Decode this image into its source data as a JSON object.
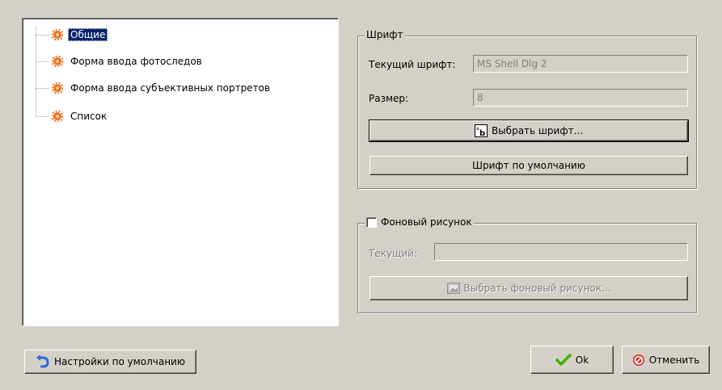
{
  "tree": {
    "items": [
      {
        "label": "Общие",
        "selected": true
      },
      {
        "label": "Форма ввода фотоследов",
        "selected": false
      },
      {
        "label": "Форма ввода субъективных портретов",
        "selected": false
      },
      {
        "label": "Список",
        "selected": false
      }
    ]
  },
  "font_group": {
    "title": "Шрифт",
    "current_label": "Текущий шрифт:",
    "current_value": "MS Shell Dlg 2",
    "size_label": "Размер:",
    "size_value": "8",
    "choose_button": "Выбрать шрифт...",
    "default_button": "Шрифт по умолчанию"
  },
  "background_group": {
    "title": "Фоновый рисунок",
    "checked": false,
    "current_label": "Текущий:",
    "current_value": "",
    "choose_button": "Выбрать фоновый рисунок..."
  },
  "footer": {
    "defaults_button": "Настройки по умолчанию",
    "ok_button": "Ok",
    "cancel_button": "Отменить"
  },
  "colors": {
    "selection": "#0a246a",
    "dialog_bg": "#d4d0c8",
    "gear": "#f07020",
    "ok_check": "#3cb400",
    "cancel_red": "#e02020",
    "defaults_arrow": "#2a6cd6"
  },
  "icons": {
    "tree_item": "gear-icon",
    "choose_font": "font-ab-icon",
    "choose_background": "image-icon",
    "defaults": "undo-arrow-icon",
    "ok": "checkmark-icon",
    "cancel": "stop-icon"
  }
}
